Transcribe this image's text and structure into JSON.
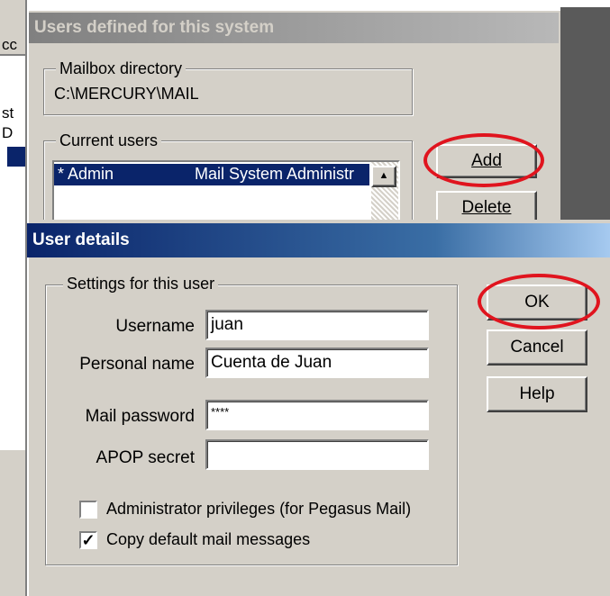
{
  "background": {
    "left_fragments": [
      "cc",
      "st",
      "D"
    ]
  },
  "users_dialog": {
    "title": "Users defined for this system",
    "mailbox_group_label": "Mailbox directory",
    "mailbox_path": "C:\\MERCURY\\MAIL",
    "current_users_label": "Current users",
    "users": [
      {
        "name": "* Admin",
        "description": "Mail System Administr"
      }
    ],
    "add_label": "Add",
    "delete_label": "Delete"
  },
  "details_dialog": {
    "title": "User details",
    "settings_group_label": "Settings for this user",
    "username_label": "Username",
    "username_value": "juan",
    "personal_name_label": "Personal name",
    "personal_name_value": "Cuenta de Juan",
    "mail_password_label": "Mail password",
    "mail_password_value": "****",
    "apop_secret_label": "APOP secret",
    "apop_secret_value": "",
    "admin_privileges_label": "Administrator privileges (for Pegasus Mail)",
    "admin_privileges_checked": false,
    "copy_default_label": "Copy default mail messages",
    "copy_default_checked": true,
    "ok_label": "OK",
    "cancel_label": "Cancel",
    "help_label": "Help"
  },
  "annotations": {
    "highlight_color": "#e0141e"
  }
}
